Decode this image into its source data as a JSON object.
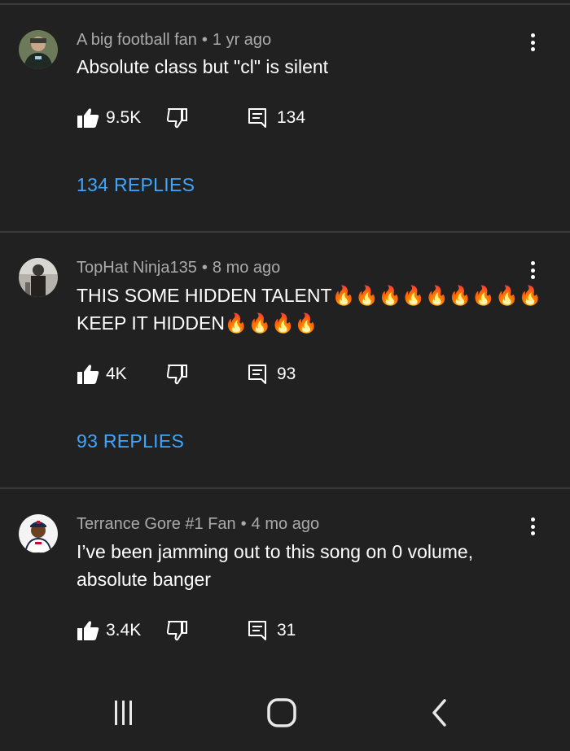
{
  "comments": [
    {
      "author": "A big football fan",
      "time": "1 yr ago",
      "text": "Absolute class but \"cl\" is silent",
      "likes": "9.5K",
      "reply_count": "134",
      "replies_label": "134 REPLIES"
    },
    {
      "author": "TopHat Ninja135",
      "time": "8 mo ago",
      "text_line1": "THIS SOME HIDDEN TALENT🔥🔥🔥🔥🔥🔥🔥🔥🔥",
      "text_line2": "KEEP IT HIDDEN🔥🔥🔥🔥",
      "likes": "4K",
      "reply_count": "93",
      "replies_label": "93 REPLIES"
    },
    {
      "author": "Terrance Gore #1 Fan",
      "time": "4 mo ago",
      "text": "I’ve been jamming out to this song on 0 volume, absolute banger",
      "likes": "3.4K",
      "reply_count": "31"
    }
  ],
  "icons": {
    "like": "thumbs-up-icon",
    "dislike": "thumbs-down-icon",
    "reply": "comment-icon",
    "more": "more-vertical-icon",
    "nav_recents": "recents-icon",
    "nav_home": "home-icon",
    "nav_back": "back-icon"
  },
  "colors": {
    "background": "#212121",
    "divider": "#3a3a3a",
    "meta": "#aaaaaa",
    "link": "#3ea6ff"
  }
}
